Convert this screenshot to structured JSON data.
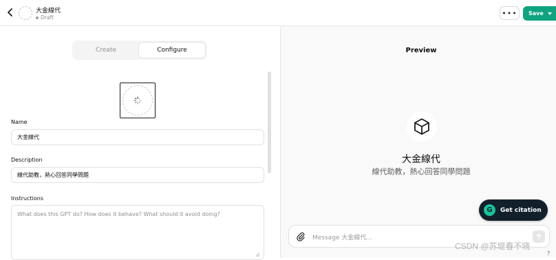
{
  "topbar": {
    "gpt_name": "大金線代",
    "status": "Draft",
    "more_label": "•••",
    "save_label": "Save"
  },
  "editor": {
    "tabs": [
      {
        "label": "Create",
        "active": false
      },
      {
        "label": "Configure",
        "active": true
      }
    ],
    "name_label": "Name",
    "name_value": "大金線代",
    "description_label": "Description",
    "description_value": "線代助教，熱心回答同學問題",
    "instructions_label": "Instructions",
    "instructions_placeholder": "What does this GPT do? How does it behave? What should it avoid doing?"
  },
  "preview": {
    "title": "Preview",
    "gpt_name": "大金線代",
    "gpt_description": "線代助教，熱心回答同學問題",
    "message_placeholder": "Message 大金線代...",
    "citation_button": "Get citation",
    "citation_icon_letter": "G"
  },
  "overlay": {
    "watermark": "CSDN @苏堤春不晓",
    "help": "?"
  },
  "colors": {
    "accent": "#10a37f",
    "citation_bg": "#12202b",
    "citation_icon": "#15c39a"
  },
  "icons": [
    "back-arrow-icon",
    "avatar-placeholder-icon",
    "spinner-icon",
    "cube-icon",
    "paperclip-icon",
    "send-arrow-icon",
    "resize-handle-icon"
  ]
}
